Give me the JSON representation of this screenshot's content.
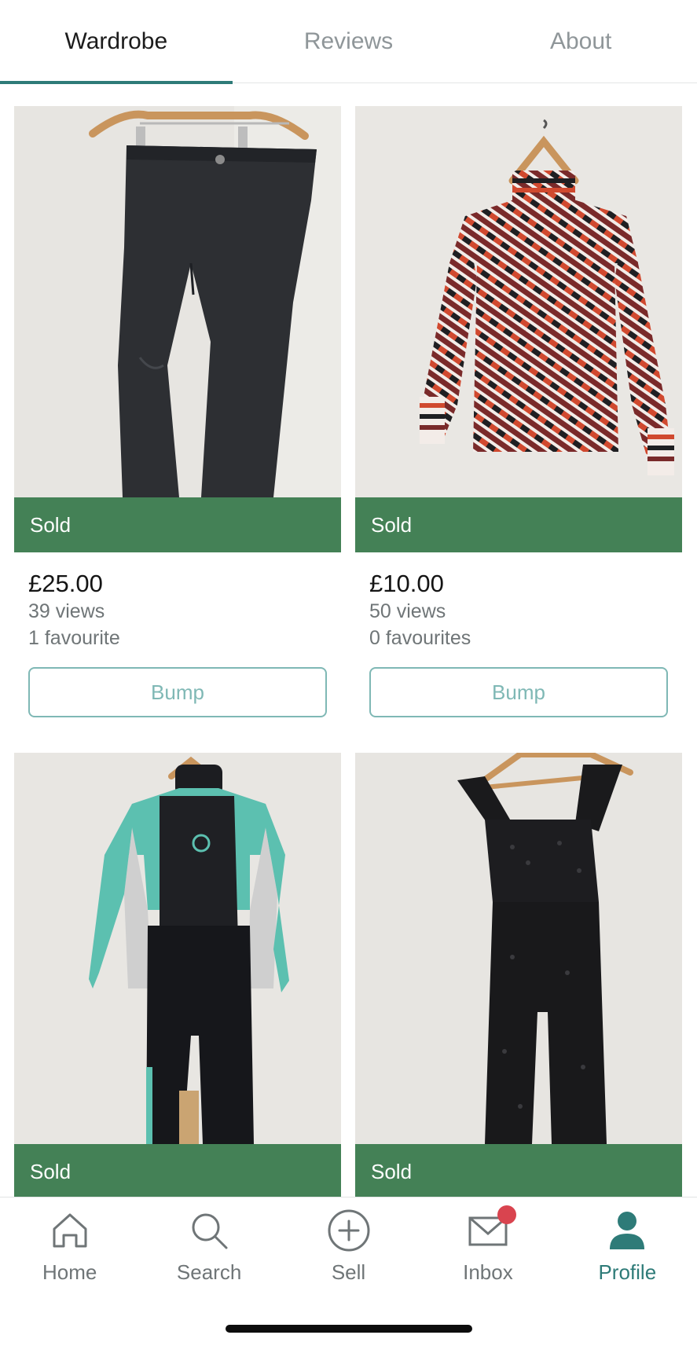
{
  "tabs": [
    {
      "label": "Wardrobe",
      "active": true
    },
    {
      "label": "Reviews",
      "active": false
    },
    {
      "label": "About",
      "active": false
    }
  ],
  "items": [
    {
      "status": "Sold",
      "price": "£25.00",
      "views": "39 views",
      "favourites": "1 favourite",
      "bump_label": "Bump",
      "photo": "black-jeans-on-hanger"
    },
    {
      "status": "Sold",
      "price": "£10.00",
      "views": "50 views",
      "favourites": "0 favourites",
      "bump_label": "Bump",
      "photo": "patterned-turtleneck-top-on-hanger"
    },
    {
      "status": "Sold",
      "photo": "wetsuit-on-hanger"
    },
    {
      "status": "Sold",
      "photo": "black-eyelet-jumpsuit-on-hanger"
    }
  ],
  "bottom_nav": [
    {
      "label": "Home",
      "icon": "home-icon",
      "active": false
    },
    {
      "label": "Search",
      "icon": "search-icon",
      "active": false
    },
    {
      "label": "Sell",
      "icon": "plus-circle-icon",
      "active": false
    },
    {
      "label": "Inbox",
      "icon": "mail-icon",
      "active": false,
      "has_badge": true
    },
    {
      "label": "Profile",
      "icon": "person-icon",
      "active": true
    }
  ],
  "colors": {
    "accent": "#2e7b78",
    "sold_banner": "#448156",
    "bump_border": "#7fb8b5",
    "badge": "#d9444f"
  }
}
